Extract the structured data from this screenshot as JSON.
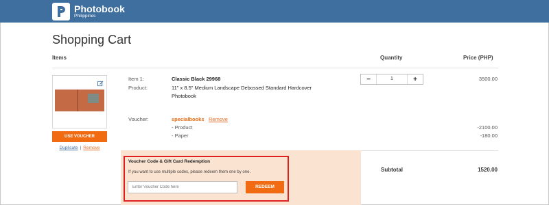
{
  "brand": {
    "name": "Photobook",
    "region": "Philippines"
  },
  "page": {
    "title": "Shopping Cart"
  },
  "table": {
    "headers": {
      "items": "Items",
      "quantity": "Quantity",
      "price": "Price (PHP)"
    }
  },
  "cart_item": {
    "item_label": "Item 1:",
    "item_name": "Classic Black 29968",
    "product_label": "Product:",
    "product_line1": "11\" x 8.5\" Medium Landscape Debossed Standard Hardcover",
    "product_line2": "Photobook",
    "voucher_label": "Voucher:",
    "voucher_code": "specialbooks",
    "voucher_remove": "Remove",
    "discount_product_label": "- Product",
    "discount_paper_label": "- Paper",
    "price": "3500.00",
    "discount_product": "-2100.00",
    "discount_paper": "-180.00",
    "quantity": "1",
    "use_voucher_label": "USE VOUCHER",
    "duplicate_label": "Duplicate",
    "separator": "|",
    "remove_label": "Remove",
    "decrement": "−",
    "increment": "+"
  },
  "redemption": {
    "title": "Voucher Code & Gift Card Redemption",
    "note": "If you want to use multiple codes, please redeem them one by one.",
    "input_placeholder": "Enter Voucher Code here",
    "input_value": "",
    "redeem_label": "REDEEM"
  },
  "summary": {
    "subtotal_label": "Subtotal",
    "subtotal_value": "1520.00"
  },
  "colors": {
    "header_bar": "#3f6f9f",
    "accent_orange": "#f06b12",
    "panel_bg": "#fbe3d2",
    "highlight_border": "#e02020"
  },
  "icons": {
    "edit": "edit-icon",
    "logo": "photobook-logo-icon"
  }
}
